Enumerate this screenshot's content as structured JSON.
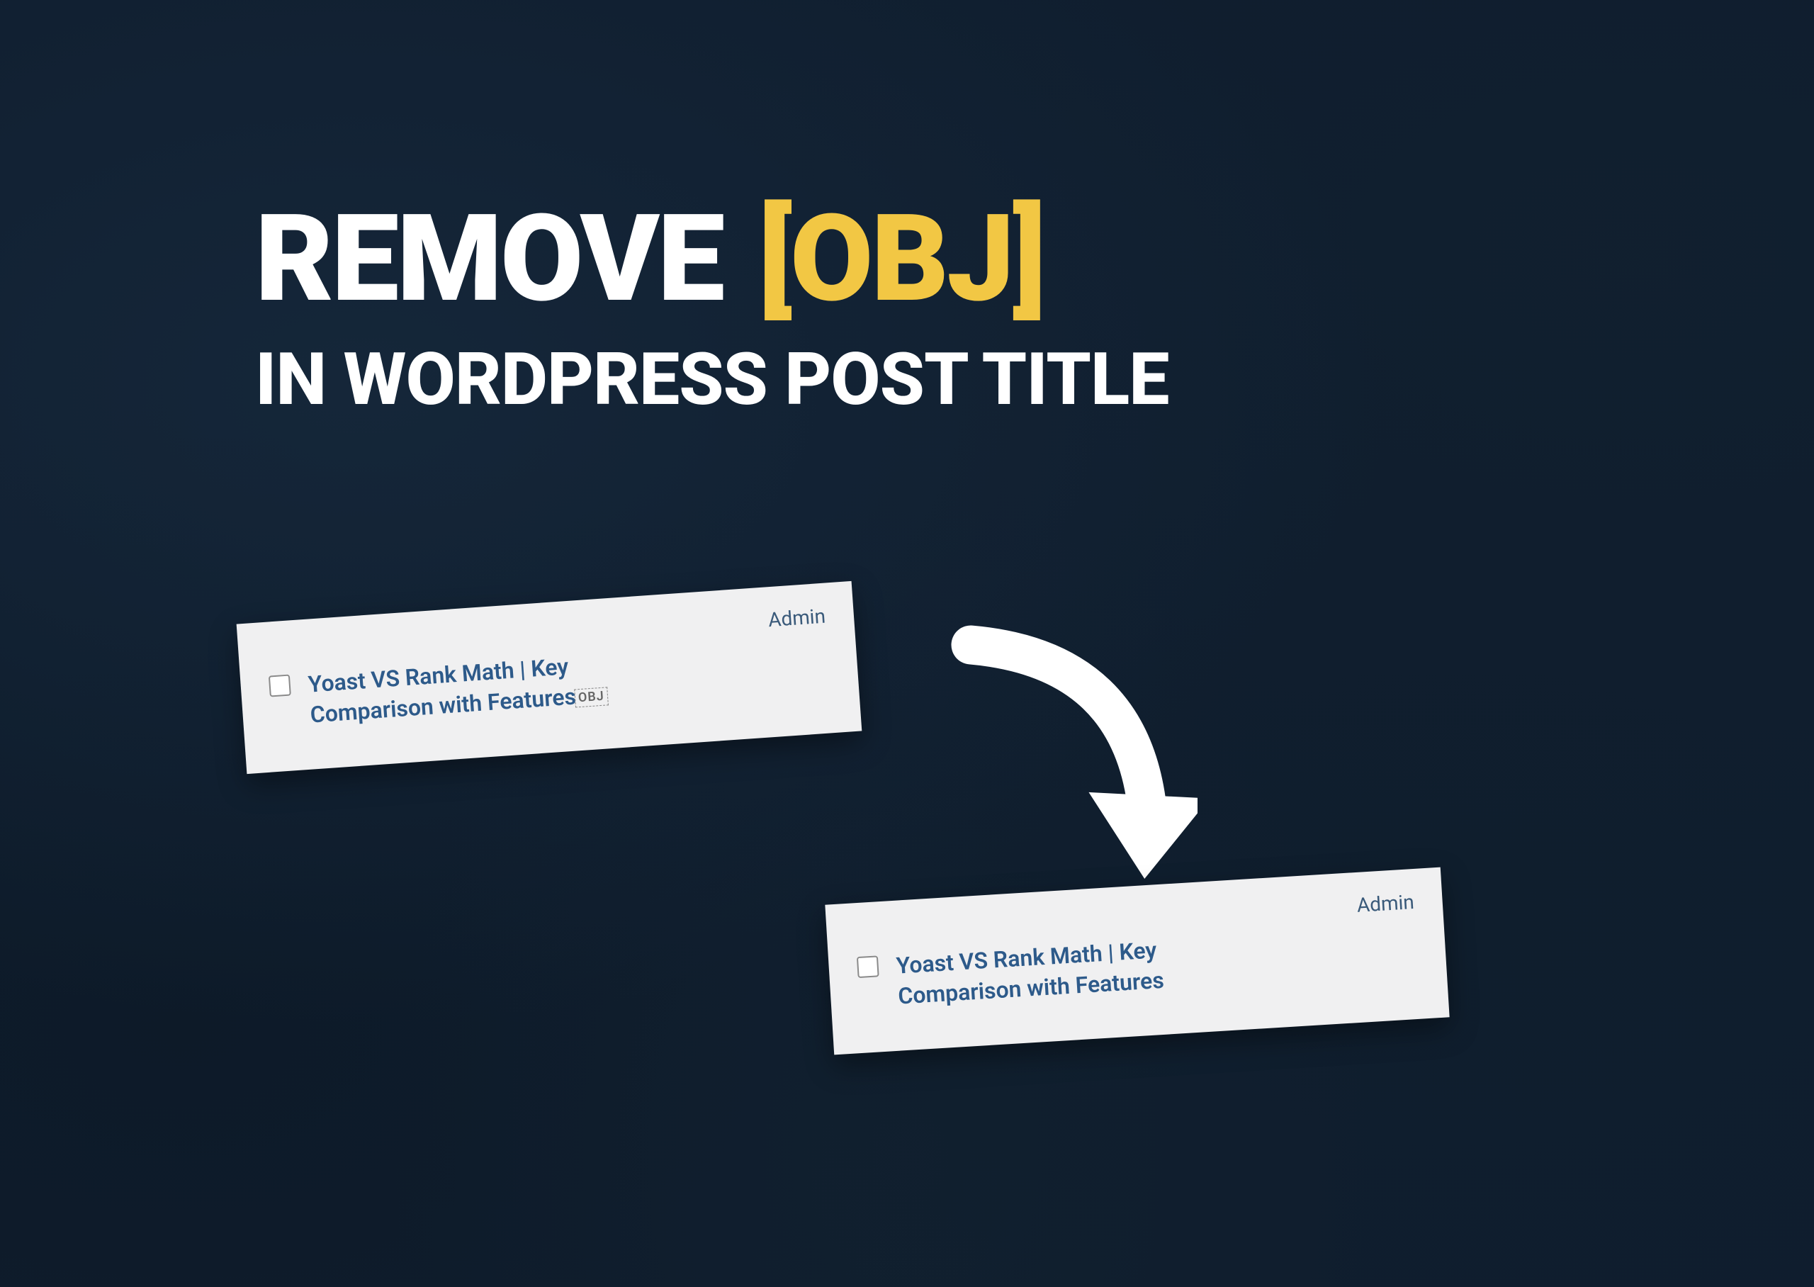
{
  "heading": {
    "remove": "REMOVE",
    "bracket_left": "[",
    "obj": "OBJ",
    "bracket_right": "]",
    "subtitle": "IN WORDPRESS POST TITLE"
  },
  "card_before": {
    "author": "Admin",
    "title_line1": "Yoast VS Rank Math | Key",
    "title_line2": "Comparison with Features",
    "obj_marker": "OBJ"
  },
  "card_after": {
    "author": "Admin",
    "title_line1": "Yoast VS Rank Math | Key",
    "title_line2": "Comparison with Features"
  }
}
